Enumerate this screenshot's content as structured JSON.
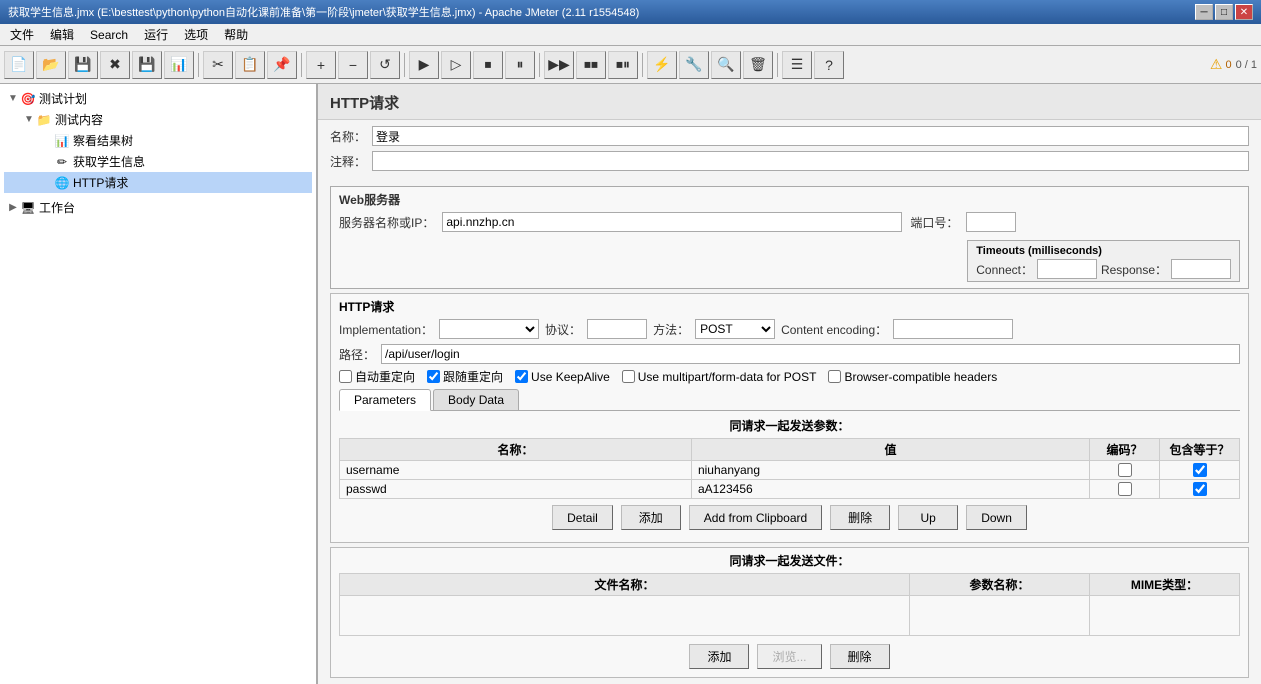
{
  "titlebar": {
    "text": "获取学生信息.jmx (E:\\besttest\\python\\python自动化课前准备\\第一阶段\\jmeter\\获取学生信息.jmx) - Apache JMeter (2.11 r1554548)",
    "minimize": "─",
    "maximize": "□",
    "close": "✕"
  },
  "menubar": {
    "items": [
      "文件",
      "编辑",
      "Search",
      "运行",
      "选项",
      "帮助"
    ]
  },
  "toolbar": {
    "buttons": [
      {
        "name": "new-btn",
        "icon": "📄"
      },
      {
        "name": "open-btn",
        "icon": "📂"
      },
      {
        "name": "save-btn",
        "icon": "💾"
      },
      {
        "name": "close-btn",
        "icon": "✖"
      },
      {
        "name": "save2-btn",
        "icon": "💾"
      },
      {
        "name": "report-btn",
        "icon": "📊"
      },
      {
        "name": "cut-btn",
        "icon": "✂"
      },
      {
        "name": "copy-btn",
        "icon": "📋"
      },
      {
        "name": "paste-btn",
        "icon": "📌"
      },
      {
        "name": "add-btn",
        "icon": "+"
      },
      {
        "name": "remove-btn",
        "icon": "−"
      },
      {
        "name": "refresh-btn",
        "icon": "↺"
      },
      {
        "name": "play-btn",
        "icon": "▶"
      },
      {
        "name": "play-no-pause-btn",
        "icon": "▷"
      },
      {
        "name": "stop-btn",
        "icon": "⏹"
      },
      {
        "name": "shutdown-btn",
        "icon": "⏸"
      },
      {
        "name": "play-remote-btn",
        "icon": "▶▶"
      },
      {
        "name": "stop-remote-btn",
        "icon": "⏹⏹"
      },
      {
        "name": "stop-remote2-btn",
        "icon": "⏹⏸"
      },
      {
        "name": "jmeter-icon-btn",
        "icon": "⚡"
      },
      {
        "name": "funnel-btn",
        "icon": "🔧"
      },
      {
        "name": "search-btn",
        "icon": "🔍"
      },
      {
        "name": "clear-btn",
        "icon": "🗑"
      },
      {
        "name": "list-btn",
        "icon": "☰"
      },
      {
        "name": "help-btn",
        "icon": "?"
      }
    ],
    "warnings": "0",
    "counter": "0 / 1"
  },
  "tree": {
    "items": [
      {
        "id": "test-plan",
        "label": "测试计划",
        "level": 0,
        "icon": "🎯",
        "expanded": true
      },
      {
        "id": "test-content",
        "label": "测试内容",
        "level": 1,
        "icon": "📁",
        "expanded": true
      },
      {
        "id": "result-tree",
        "label": "察看结果树",
        "level": 2,
        "icon": "📊"
      },
      {
        "id": "get-student",
        "label": "获取学生信息",
        "level": 2,
        "icon": "✏"
      },
      {
        "id": "http-request",
        "label": "HTTP请求",
        "level": 2,
        "icon": "🌐",
        "selected": true
      },
      {
        "id": "workbench",
        "label": "工作台",
        "level": 0,
        "icon": "🖥"
      }
    ]
  },
  "main": {
    "panel_title": "HTTP请求",
    "name_label": "名称：",
    "name_value": "登录",
    "comment_label": "注释：",
    "web_server": {
      "group_title": "Web服务器",
      "server_label": "服务器名称或IP：",
      "server_value": "api.nnzhp.cn",
      "port_label": "端口号：",
      "port_value": "",
      "timeouts_title": "Timeouts (milliseconds)",
      "connect_label": "Connect：",
      "connect_value": "",
      "response_label": "Response：",
      "response_value": ""
    },
    "http_request": {
      "group_title": "HTTP请求",
      "impl_label": "Implementation：",
      "impl_value": "",
      "protocol_label": "协议：",
      "protocol_value": "",
      "method_label": "方法：",
      "method_value": "POST",
      "encoding_label": "Content encoding：",
      "encoding_value": "",
      "path_label": "路径：",
      "path_value": "/api/user/login",
      "cb_redirect": "自动重定向",
      "cb_follow": "跟随重定向",
      "cb_keepalive": "Use KeepAlive",
      "cb_multipart": "Use multipart/form-data for POST",
      "cb_browser": "Browser-compatible headers"
    },
    "tabs": [
      "Parameters",
      "Body Data"
    ],
    "active_tab": "Parameters",
    "params_section": {
      "title": "同请求一起发送参数：",
      "columns": [
        "名称：",
        "值",
        "编码？",
        "包含等于？"
      ],
      "rows": [
        {
          "name": "username",
          "value": "niuhanyang",
          "encode": false,
          "include": true
        },
        {
          "name": "passwd",
          "value": "aA123456",
          "encode": false,
          "include": true
        }
      ],
      "buttons": [
        "Detail",
        "添加",
        "Add from Clipboard",
        "删除",
        "Up",
        "Down"
      ]
    },
    "file_section": {
      "title": "同请求一起发送文件：",
      "columns": [
        "文件名称：",
        "参数名称：",
        "MIME类型："
      ],
      "rows": [],
      "buttons": [
        "添加",
        "浏览...",
        "删除"
      ]
    }
  }
}
